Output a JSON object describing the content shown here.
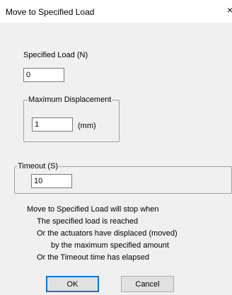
{
  "window": {
    "title": "Move to Specified Load",
    "close_glyph": "×"
  },
  "specified_load": {
    "label": "Specified Load (N)",
    "value": "0"
  },
  "max_displacement": {
    "group_label": "Maximum Displacement",
    "value": "1",
    "unit": "(mm)"
  },
  "timeout": {
    "group_label": "Timeout (S)",
    "value": "10"
  },
  "info": {
    "line1": "Move to Specified Load will stop when",
    "line2": "The specified load is reached",
    "line3": "Or the actuators have displaced (moved)",
    "line4": "by the maximum specified amount",
    "line5": "Or the Timeout time has elapsed"
  },
  "buttons": {
    "ok": "OK",
    "cancel": "Cancel"
  }
}
